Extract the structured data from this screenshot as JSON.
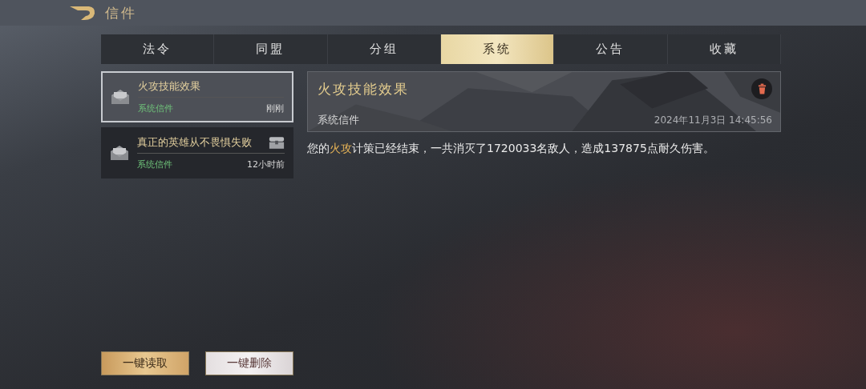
{
  "header": {
    "title": "信件"
  },
  "tabs": [
    {
      "label": "法令",
      "selected": false
    },
    {
      "label": "同盟",
      "selected": false
    },
    {
      "label": "分组",
      "selected": false
    },
    {
      "label": "系统",
      "selected": true
    },
    {
      "label": "公告",
      "selected": false
    },
    {
      "label": "收藏",
      "selected": false
    }
  ],
  "mails": [
    {
      "title": "火攻技能效果",
      "sender": "系统信件",
      "time": "刚刚",
      "selected": true,
      "has_attachment": false
    },
    {
      "title": "真正的英雄从不畏惧失败",
      "sender": "系统信件",
      "time": "12小时前",
      "selected": false,
      "has_attachment": true
    }
  ],
  "detail": {
    "title": "火攻技能效果",
    "sender": "系统信件",
    "date": "2024年11月3日 14:45:56",
    "message": "您的**火攻**计策已经结束，一共消灭了1720033名敌人，造成137875点耐久伤害。"
  },
  "buttons": [
    {
      "label": "一键读取",
      "kind": "primary"
    },
    {
      "label": "一键删除",
      "kind": "secondary"
    }
  ]
}
